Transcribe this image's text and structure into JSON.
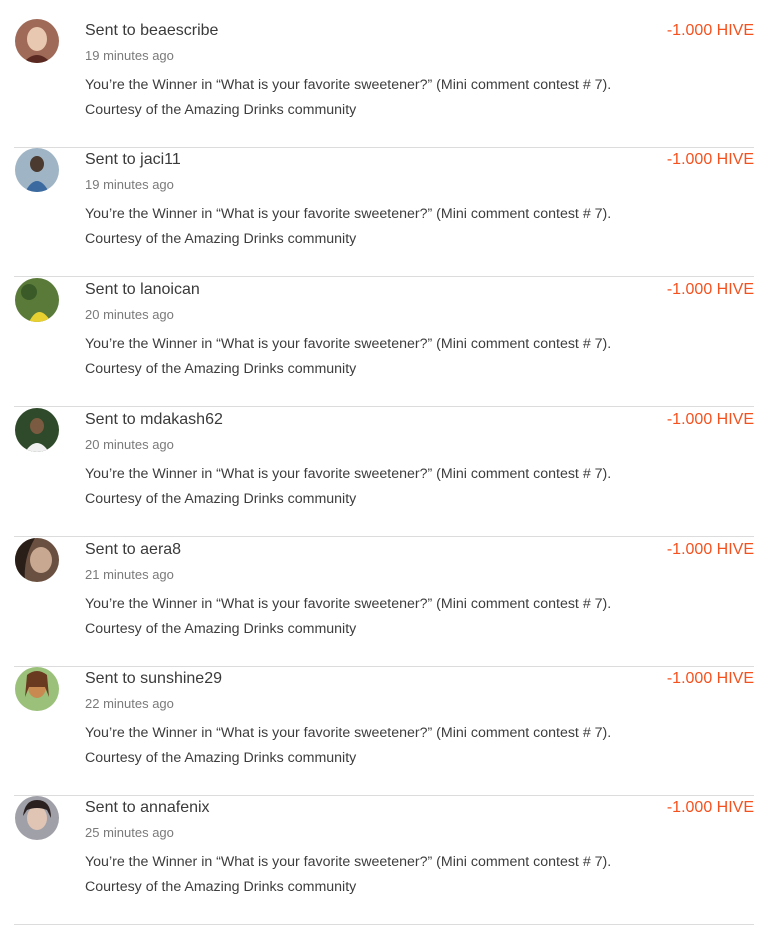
{
  "transfers": [
    {
      "prefix": "Sent to",
      "username": "beaescribe",
      "time": "19 minutes ago",
      "memo_line1": "You’re the Winner in “What is your favorite sweetener?” (Mini comment contest # 7).",
      "memo_line2": "Courtesy of the Amazing Drinks community",
      "amount": "-1.000 HIVE",
      "avatar_colors": [
        "#a06a58",
        "#e8c8b0",
        "#5a2a22"
      ]
    },
    {
      "prefix": "Sent to",
      "username": "jaci11",
      "time": "19 minutes ago",
      "memo_line1": "You’re the Winner in “What is your favorite sweetener?” (Mini comment contest # 7).",
      "memo_line2": "Courtesy of the Amazing Drinks community",
      "amount": "-1.000 HIVE",
      "avatar_colors": [
        "#9fb4c4",
        "#3a6aa0",
        "#4a3a30"
      ]
    },
    {
      "prefix": "Sent to",
      "username": "lanoican",
      "time": "20 minutes ago",
      "memo_line1": "You’re the Winner in “What is your favorite sweetener?” (Mini comment contest # 7).",
      "memo_line2": "Courtesy of the Amazing Drinks community",
      "amount": "-1.000 HIVE",
      "avatar_colors": [
        "#5a7a3a",
        "#e8d030",
        "#3a5a28"
      ]
    },
    {
      "prefix": "Sent to",
      "username": "mdakash62",
      "time": "20 minutes ago",
      "memo_line1": "You’re the Winner in “What is your favorite sweetener?” (Mini comment contest # 7).",
      "memo_line2": "Courtesy of the Amazing Drinks community",
      "amount": "-1.000 HIVE",
      "avatar_colors": [
        "#2f4a2a",
        "#f0f0f0",
        "#7a5a40"
      ]
    },
    {
      "prefix": "Sent to",
      "username": "aera8",
      "time": "21 minutes ago",
      "memo_line1": "You’re the Winner in “What is your favorite sweetener?” (Mini comment contest # 7).",
      "memo_line2": "Courtesy of the Amazing Drinks community",
      "amount": "-1.000 HIVE",
      "avatar_colors": [
        "#6a5040",
        "#c8a890",
        "#2a1e18"
      ]
    },
    {
      "prefix": "Sent to",
      "username": "sunshine29",
      "time": "22 minutes ago",
      "memo_line1": "You’re the Winner in “What is your favorite sweetener?” (Mini comment contest # 7).",
      "memo_line2": "Courtesy of the Amazing Drinks community",
      "amount": "-1.000 HIVE",
      "avatar_colors": [
        "#9ac07a",
        "#c88a50",
        "#6a3a20"
      ]
    },
    {
      "prefix": "Sent to",
      "username": "annafenix",
      "time": "25 minutes ago",
      "memo_line1": "You’re the Winner in “What is your favorite sweetener?” (Mini comment contest # 7).",
      "memo_line2": "Courtesy of the Amazing Drinks community",
      "amount": "-1.000 HIVE",
      "avatar_colors": [
        "#a0a0a8",
        "#e0c4b4",
        "#2a2020"
      ]
    }
  ]
}
